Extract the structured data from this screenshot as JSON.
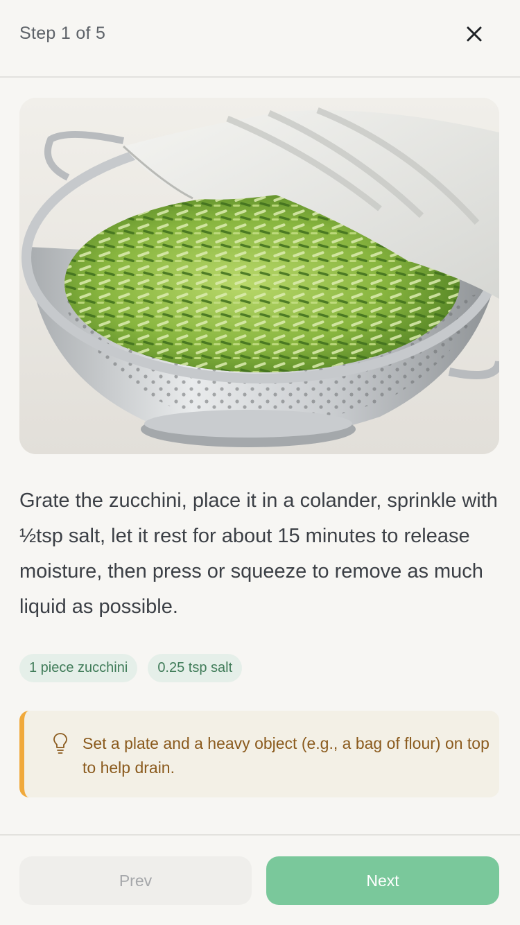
{
  "header": {
    "step_label": "Step 1 of 5",
    "close_icon": "close-icon"
  },
  "step": {
    "image_icon": "zucchini-colander-photo",
    "instruction": "Grate the zucchini, place it in a colander, sprinkle with ½tsp salt, let it rest for about 15 minutes to release moisture, then press or squeeze to remove as much liquid as possible.",
    "ingredients": [
      {
        "label": "1 piece zucchini"
      },
      {
        "label": "0.25 tsp salt"
      }
    ],
    "tip": {
      "icon": "lightbulb-icon",
      "text": "Set a plate and a heavy object (e.g., a bag of flour) on top to help drain."
    }
  },
  "footer": {
    "prev_label": "Prev",
    "next_label": "Next"
  },
  "colors": {
    "accent": "#7ac89b",
    "chip_bg": "#e5efe9",
    "chip_text": "#3f7b58",
    "tip_border": "#f0a93b",
    "tip_bg": "#f3f0e6",
    "tip_text": "#8a5a1d"
  }
}
